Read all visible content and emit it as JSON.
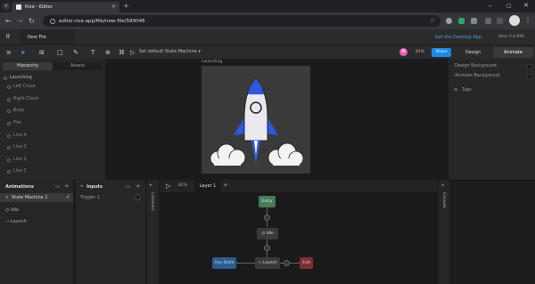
{
  "browser": {
    "tab_title": "Rive - Editor",
    "url": "editor.rive.app/file/new-file/589046",
    "new_tab": "+"
  },
  "rive": {
    "file_tab": "New File",
    "desktop_link": "Get the Desktop App",
    "beta": "Beta 0.8.986",
    "state_machine_select": "Set default State Machine",
    "avatar": "M",
    "zoom": "81%",
    "share": "Share",
    "design": "Design",
    "animate": "Animate"
  },
  "left": {
    "tabs": [
      "Hierarchy",
      "Assets"
    ],
    "items": [
      "Launching",
      "Left Cloud",
      "Right Cloud",
      "Body",
      "Fire",
      "Line 4",
      "Line 3",
      "Line 2",
      "Line 1"
    ]
  },
  "stage": {
    "artboard_label": "Launching"
  },
  "right": {
    "design_background": "Design Background",
    "animate_background": "Animate Background",
    "tags": "Tags"
  },
  "bottom": {
    "animations_header": "Animations",
    "inputs_header": "Inputs",
    "animations": [
      "State Machine 1",
      "Idle",
      "Launch"
    ],
    "inputs": [
      "Trigger 1"
    ],
    "listeners": "Listeners",
    "console": "Console",
    "zoom": "82%",
    "layer": "Layer 1",
    "nodes": {
      "entry": "Entry",
      "idle": "Idle",
      "any": "Any State",
      "launch": "Launch",
      "exit": "Exit"
    }
  },
  "colors": {
    "accent": "#1e88e5",
    "rocket_blue": "#2f57e0",
    "entry": "#4a7a5a",
    "any": "#2d5c8e",
    "exit": "#7a2f36"
  }
}
